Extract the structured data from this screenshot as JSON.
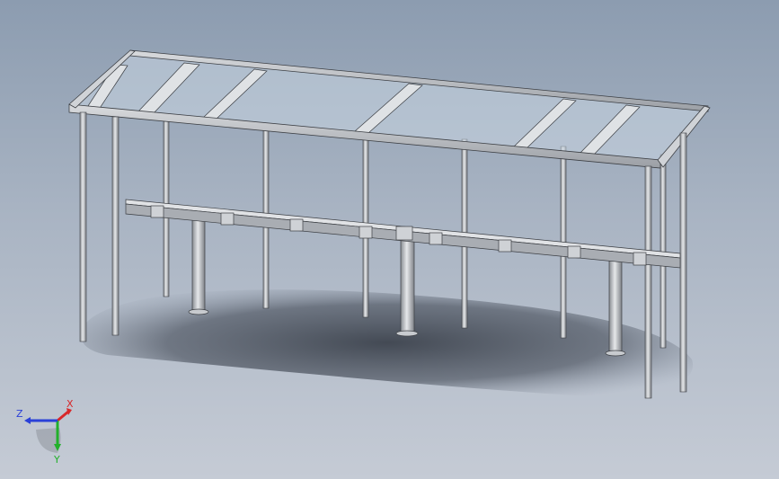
{
  "viewport": {
    "background_top": "#8c9cb0",
    "background_bottom": "#c5cbd5"
  },
  "model": {
    "frame_color": "#c9ccd0",
    "frame_edge_color": "#3c3f44",
    "glass_color": "#c8d6e2",
    "shadow_color": "#3a404a"
  },
  "triad": {
    "x_label": "X",
    "y_label": "Y",
    "z_label": "Z",
    "x_color": "#d8282a",
    "y_color": "#22b02a",
    "z_color": "#2a40d8"
  }
}
